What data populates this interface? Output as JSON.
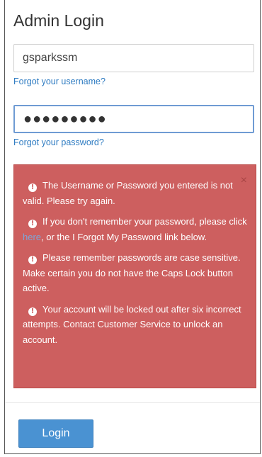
{
  "header": {
    "title": "Admin Login"
  },
  "form": {
    "username_value": "gsparkssm",
    "password_masked": "●●●●●●●●●",
    "forgot_username_link": "Forgot your username?",
    "forgot_password_link": "Forgot your password?"
  },
  "alert": {
    "close_glyph": "×",
    "icon": "exclamation-circle-icon",
    "messages": [
      {
        "text": "The Username or Password you entered is not valid. Please try again."
      },
      {
        "text_before": "If you don't remember your password, please click ",
        "link": "here",
        "text_after": ", or the I Forgot My Password link below."
      },
      {
        "text": "Please remember passwords are case sensitive. Make certain you do not have the Caps Lock button active."
      },
      {
        "text": "Your account will be locked out after six incorrect attempts. Contact Customer Service to unlock an account."
      }
    ],
    "colors": {
      "background": "#cd5f5f",
      "text": "#ffffff",
      "link": "#7fa4d6"
    }
  },
  "actions": {
    "login_label": "Login",
    "login_color": "#4a92d2"
  }
}
